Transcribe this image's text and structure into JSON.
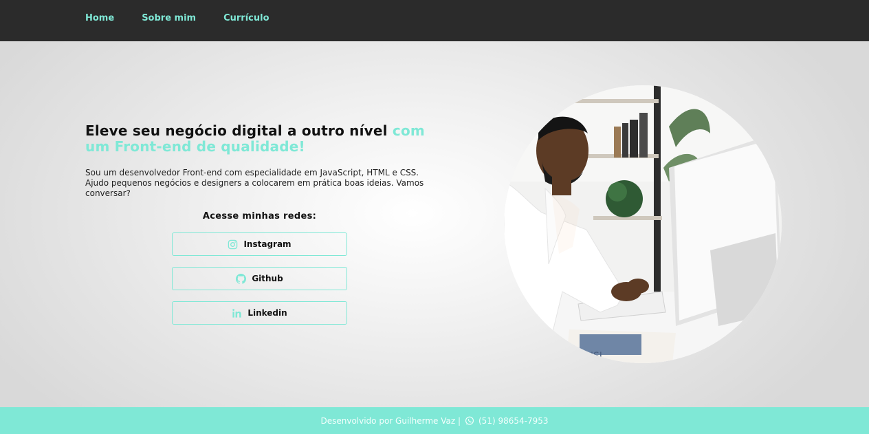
{
  "nav": {
    "items": [
      {
        "label": "Home"
      },
      {
        "label": "Sobre mim"
      },
      {
        "label": "Currículo"
      }
    ]
  },
  "hero": {
    "headline_main": "Eleve seu negócio digital a outro nível ",
    "headline_accent": "com um Front-end de qualidade!",
    "description": "Sou um desenvolvedor Front-end com especialidade em JavaScript, HTML e CSS. Ajudo pequenos negócios e designers a colocarem em prática boas ideias. Vamos conversar?",
    "social_title": "Acesse minhas redes:",
    "social": [
      {
        "label": "Instagram",
        "icon": "instagram-icon"
      },
      {
        "label": "Github",
        "icon": "github-icon"
      },
      {
        "label": "Linkedin",
        "icon": "linkedin-icon"
      }
    ],
    "image_caption": "BUSI"
  },
  "footer": {
    "credit": "Desenvolvido por Guilherme Vaz |",
    "phone": "(51) 98654-7953",
    "icon": "whatsapp-icon"
  },
  "colors": {
    "accent": "#7fe8d6",
    "topbar": "#2b2b2b",
    "text": "#111111"
  }
}
